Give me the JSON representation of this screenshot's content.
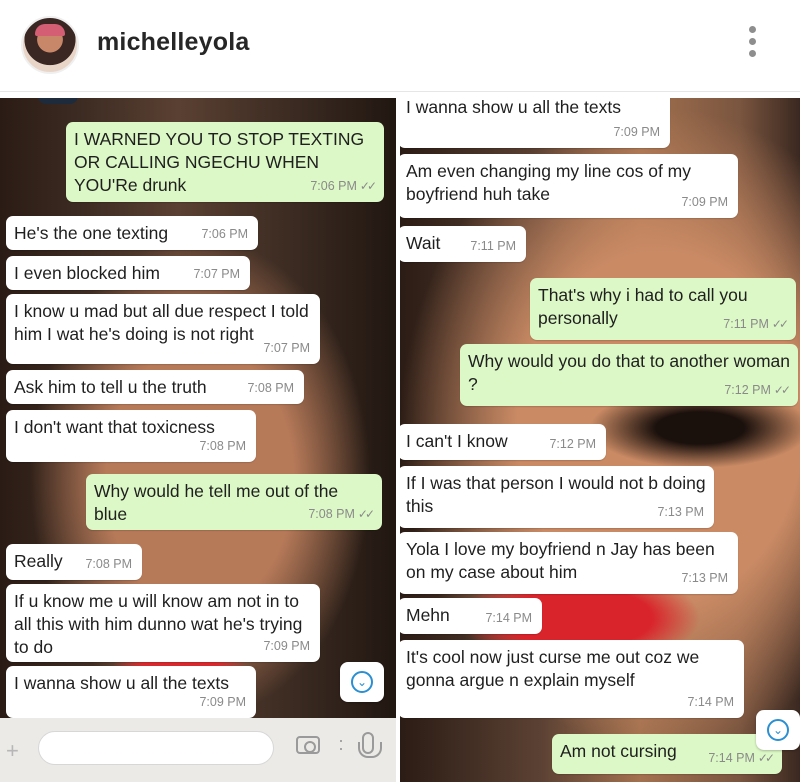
{
  "header": {
    "username": "michelleyola",
    "avatar_icon": "avatar-bitmoji",
    "more_icon": "more-vertical-icon"
  },
  "left": {
    "messages": [
      {
        "text": "I WARNED YOU TO STOP TEXTING OR CALLING NGECHU WHEN YOU'Re drunk",
        "time": "7:06 PM",
        "dir": "out"
      },
      {
        "text": "He's the one texting",
        "time": "7:06 PM",
        "dir": "in"
      },
      {
        "text": "I even blocked him",
        "time": "7:07 PM",
        "dir": "in"
      },
      {
        "text": "I know u mad but all due respect I told him I wat he's doing is not right",
        "time": "7:07 PM",
        "dir": "in"
      },
      {
        "text": "Ask him to tell u the truth",
        "time": "7:08 PM",
        "dir": "in"
      },
      {
        "text": "I don't want that toxicness",
        "time": "7:08 PM",
        "dir": "in"
      },
      {
        "text": "Why would he tell me out of the blue",
        "time": "7:08 PM",
        "dir": "out"
      },
      {
        "text": "Really",
        "time": "7:08 PM",
        "dir": "in"
      },
      {
        "text": "If u know me u will know am not in to all this with him dunno wat he's trying to do",
        "time": "7:09 PM",
        "dir": "in"
      },
      {
        "text": "I wanna show u all the texts",
        "time": "7:09 PM",
        "dir": "in"
      }
    ]
  },
  "right": {
    "messages": [
      {
        "text": "I wanna show u all the texts",
        "time": "7:09 PM",
        "dir": "in"
      },
      {
        "text": "Am even changing my line cos of my boyfriend huh take",
        "time": "7:09 PM",
        "dir": "in"
      },
      {
        "text": "Wait",
        "time": "7:11 PM",
        "dir": "in"
      },
      {
        "text": "That's why i had to call you personally",
        "time": "7:11 PM",
        "dir": "out"
      },
      {
        "text": "Why would you do that to another woman ?",
        "time": "7:12 PM",
        "dir": "out"
      },
      {
        "text": "I can't I know",
        "time": "7:12 PM",
        "dir": "in"
      },
      {
        "text": "If I was that person I would not b doing this",
        "time": "7:13 PM",
        "dir": "in"
      },
      {
        "text": "Yola I love my boyfriend n Jay has been on my case about him",
        "time": "7:13 PM",
        "dir": "in"
      },
      {
        "text": "Mehn",
        "time": "7:14 PM",
        "dir": "in"
      },
      {
        "text": "It's cool now just curse me out coz we gonna argue n explain myself",
        "time": "7:14 PM",
        "dir": "in"
      },
      {
        "text": "Am not cursing",
        "time": "7:14 PM",
        "dir": "out"
      }
    ]
  },
  "ticks": "✓✓",
  "scroll_icon": "chevron-down-icon",
  "scroll_glyph": "⌄"
}
